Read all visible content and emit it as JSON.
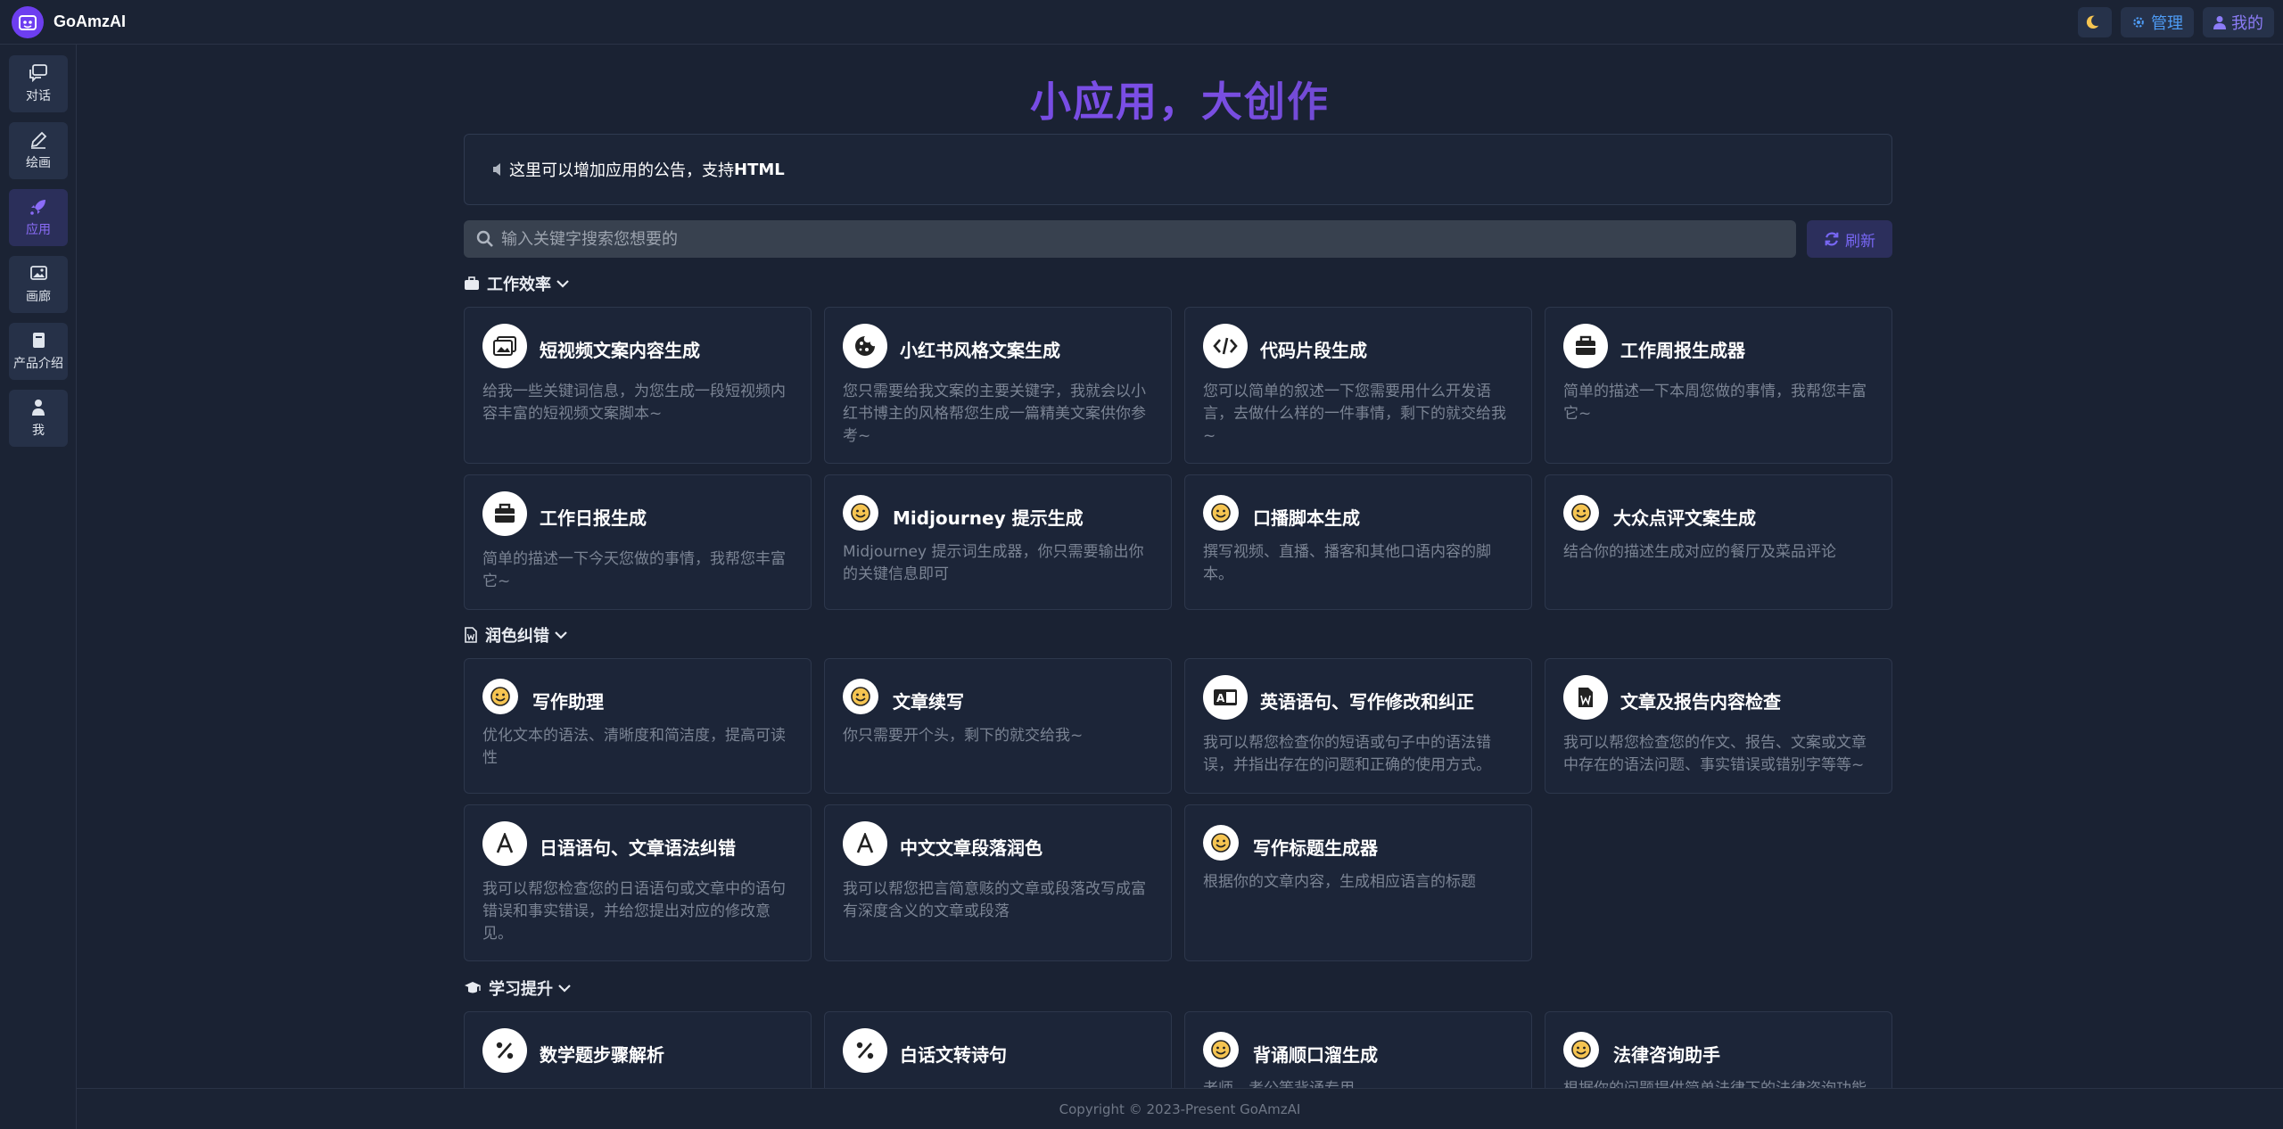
{
  "brand": {
    "name": "GoAmzAI"
  },
  "top_actions": {
    "manage": "管理",
    "mine": "我的"
  },
  "sidebar": {
    "items": [
      {
        "label": "对话",
        "icon": "chat-icon"
      },
      {
        "label": "绘画",
        "icon": "brush-icon"
      },
      {
        "label": "应用",
        "icon": "rocket-icon",
        "active": true
      },
      {
        "label": "画廊",
        "icon": "gallery-icon"
      },
      {
        "label": "产品介绍",
        "icon": "book-icon"
      },
      {
        "label": "我",
        "icon": "user-icon"
      }
    ]
  },
  "hero": {
    "title": "小应用，大创作"
  },
  "notice": {
    "text": "这里可以增加应用的公告，支持",
    "bold": "HTML"
  },
  "search": {
    "placeholder": "输入关键字搜索您想要的"
  },
  "refresh": {
    "label": "刷新"
  },
  "sections": [
    {
      "title": "工作效率",
      "icon": "briefcase-icon",
      "cards": [
        {
          "title": "短视频文案内容生成",
          "icon": "images-icon",
          "desc": "给我一些关键词信息，为您生成一段短视频内容丰富的短视频文案脚本~"
        },
        {
          "title": "小红书风格文案生成",
          "icon": "cookie-icon",
          "desc": "您只需要给我文案的主要关键字，我就会以小红书博主的风格帮您生成一篇精美文案供你参考~"
        },
        {
          "title": "代码片段生成",
          "icon": "code-icon",
          "desc": "您可以简单的叙述一下您需要用什么开发语言，去做什么样的一件事情，剩下的就交给我~"
        },
        {
          "title": "工作周报生成器",
          "icon": "briefcase-icon",
          "desc": "简单的描述一下本周您做的事情，我帮您丰富它~"
        },
        {
          "title": "工作日报生成",
          "icon": "briefcase-icon",
          "desc": "简单的描述一下今天您做的事情，我帮您丰富它~"
        },
        {
          "title": "Midjourney 提示生成",
          "icon": "smile-icon",
          "desc": "Midjourney 提示词生成器，你只需要输出你的关键信息即可"
        },
        {
          "title": "口播脚本生成",
          "icon": "smile-icon",
          "desc": "撰写视频、直播、播客和其他口语内容的脚本。"
        },
        {
          "title": "大众点评文案生成",
          "icon": "smile-icon",
          "desc": "结合你的描述生成对应的餐厅及菜品评论"
        }
      ]
    },
    {
      "title": "润色纠错",
      "icon": "word-file-icon",
      "cards": [
        {
          "title": "写作助理",
          "icon": "smile-icon",
          "desc": "优化文本的语法、清晰度和简洁度，提高可读性"
        },
        {
          "title": "文章续写",
          "icon": "smile-icon",
          "desc": "你只需要开个头，剩下的就交给我~"
        },
        {
          "title": "英语语句、写作修改和纠正",
          "icon": "language-icon",
          "desc": "我可以帮您检查你的短语或句子中的语法错误，并指出存在的问题和正确的使用方式。"
        },
        {
          "title": "文章及报告内容检查",
          "icon": "word-file-icon",
          "desc": "我可以帮您检查您的作文、报告、文案或文章中存在的语法问题、事实错误或错别字等等~"
        },
        {
          "title": "日语语句、文章语法纠错",
          "icon": "font-a-icon",
          "desc": "我可以帮您检查您的日语语句或文章中的语句错误和事实错误，并给您提出对应的修改意见。"
        },
        {
          "title": "中文文章段落润色",
          "icon": "font-a-icon",
          "desc": "我可以帮您把言简意赅的文章或段落改写成富有深度含义的文章或段落"
        },
        {
          "title": "写作标题生成器",
          "icon": "smile-icon",
          "desc": "根据你的文章内容，生成相应语言的标题"
        }
      ]
    },
    {
      "title": "学习提升",
      "icon": "graduation-cap-icon",
      "cards": [
        {
          "title": "数学题步骤解析",
          "icon": "percent-icon",
          "desc": ""
        },
        {
          "title": "白话文转诗句",
          "icon": "percent-icon",
          "desc": ""
        },
        {
          "title": "背诵顺口溜生成",
          "icon": "smile-icon",
          "desc": "老师、考公等背诵专用"
        },
        {
          "title": "法律咨询助手",
          "icon": "smile-icon",
          "desc": "根据你的问题提供简单法律下的法律咨询功能"
        }
      ]
    }
  ],
  "footer": {
    "text": "Copyright © 2023-Present GoAmzAI"
  },
  "colors": {
    "accent": "#6d3ef0",
    "background": "#1a2233",
    "card": "#1c2538"
  }
}
